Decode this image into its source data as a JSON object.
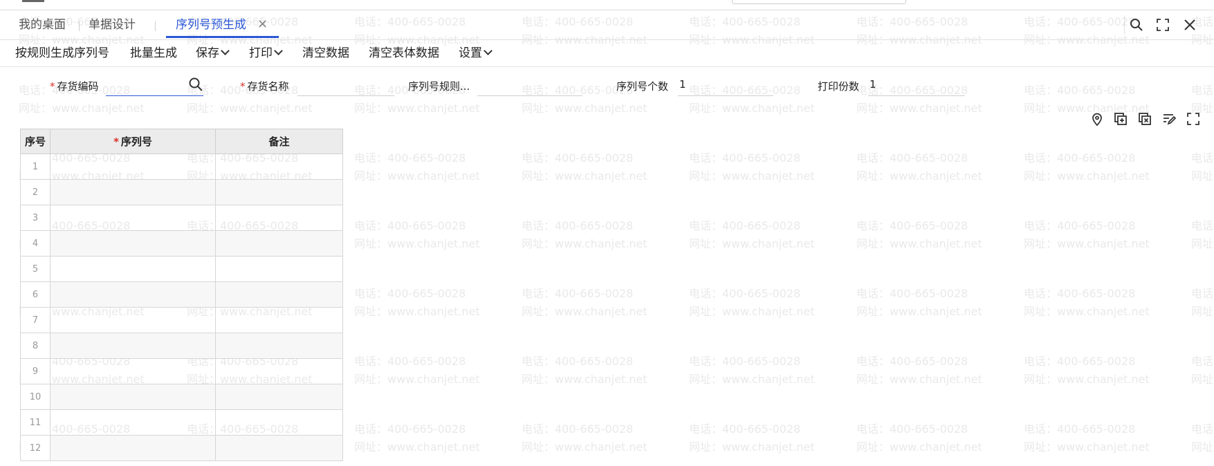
{
  "tabs": [
    {
      "label": "我的桌面",
      "active": false
    },
    {
      "label": "单据设计",
      "active": false
    },
    {
      "label": "序列号预生成",
      "active": true
    }
  ],
  "toolbar": {
    "generate_by_rule": "按规则生成序列号",
    "batch_generate": "批量生成",
    "save": "保存",
    "print": "打印",
    "clear_data": "清空数据",
    "clear_body_data": "清空表体数据",
    "settings": "设置"
  },
  "form": {
    "inventory_code": {
      "label": "存货编码",
      "required": true,
      "value": ""
    },
    "inventory_name": {
      "label": "存货名称",
      "required": true,
      "value": ""
    },
    "serial_rule": {
      "label": "序列号规则..."
    },
    "serial_count": {
      "label": "序列号个数",
      "value": "1"
    },
    "print_copies": {
      "label": "打印份数",
      "value": "1"
    }
  },
  "grid": {
    "headers": {
      "index": "序号",
      "serial_no": "序列号",
      "remark": "备注"
    },
    "rows": [
      {
        "index": "1"
      },
      {
        "index": "2"
      },
      {
        "index": "3"
      },
      {
        "index": "4"
      },
      {
        "index": "5"
      },
      {
        "index": "6"
      },
      {
        "index": "7"
      },
      {
        "index": "8"
      },
      {
        "index": "9"
      },
      {
        "index": "10"
      },
      {
        "index": "11"
      },
      {
        "index": "12"
      }
    ]
  },
  "watermark": {
    "phone": "电话：400-665-0028",
    "site": "网址：www.chanjet.net"
  },
  "icons": [
    "hamburger-icon",
    "close-icon",
    "search-icon",
    "fullscreen-icon",
    "location-pin-icon",
    "add-row-icon",
    "delete-row-icon",
    "edit-columns-icon"
  ],
  "colors": {
    "accent": "#2b57d6",
    "required": "#d9312b",
    "header_bg": "#ececec",
    "watermark": "#e9e9e9"
  }
}
